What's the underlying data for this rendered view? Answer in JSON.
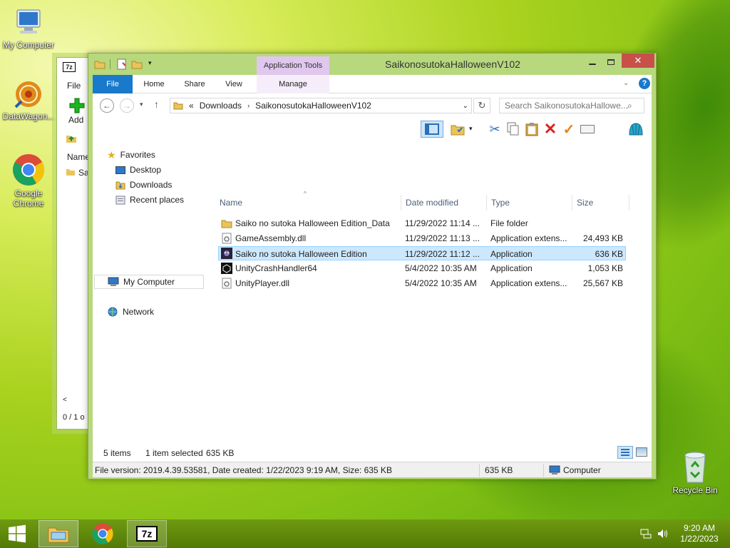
{
  "desktop": {
    "icons": [
      {
        "label": "My Computer"
      },
      {
        "label": "DataWagon..."
      },
      {
        "label": "Google Chrome"
      },
      {
        "label": "Recycle Bin"
      }
    ]
  },
  "sevenzip_window": {
    "title_icon": "7z",
    "menu_file": "File",
    "add_label": "Add",
    "col_name": "Name",
    "row_text": "Sa",
    "status": "0 / 1 o"
  },
  "explorer": {
    "title": "SaikonosutokaHalloweenV102",
    "context_tab": "Application Tools",
    "tabs": {
      "file": "File",
      "home": "Home",
      "share": "Share",
      "view": "View",
      "manage": "Manage"
    },
    "address": {
      "prefix": "«",
      "crumb1": "Downloads",
      "crumb2": "SaikonosutokaHalloweenV102"
    },
    "search_placeholder": "Search SaikonosutokaHallowe...",
    "nav": {
      "favorites": "Favorites",
      "desktop": "Desktop",
      "downloads": "Downloads",
      "recent": "Recent places",
      "computer": "My Computer",
      "network": "Network"
    },
    "columns": {
      "name": "Name",
      "date": "Date modified",
      "type": "Type",
      "size": "Size"
    },
    "files": [
      {
        "name": "Saiko no sutoka Halloween Edition_Data",
        "date": "11/29/2022 11:14 ...",
        "type": "File folder",
        "size": ""
      },
      {
        "name": "GameAssembly.dll",
        "date": "11/29/2022 11:13 ...",
        "type": "Application extens...",
        "size": "24,493 KB"
      },
      {
        "name": "Saiko no sutoka Halloween Edition",
        "date": "11/29/2022 11:12 ...",
        "type": "Application",
        "size": "636 KB"
      },
      {
        "name": "UnityCrashHandler64",
        "date": "5/4/2022 10:35 AM",
        "type": "Application",
        "size": "1,053 KB"
      },
      {
        "name": "UnityPlayer.dll",
        "date": "5/4/2022 10:35 AM",
        "type": "Application extens...",
        "size": "25,567 KB"
      }
    ],
    "status": {
      "count": "5 items",
      "selected": "1 item selected",
      "selsize": "635 KB"
    },
    "fileinfo": {
      "details": "File version: 2019.4.39.53581, Date created: 1/22/2023 9:19 AM, Size: 635 KB",
      "size": "635 KB",
      "location": "Computer"
    }
  },
  "taskbar": {
    "time": "9:20 AM",
    "date": "1/22/2023",
    "sevenzip_label": "7z"
  },
  "colors": {
    "accent": "#1979ca",
    "selection": "#cce8ff",
    "window_frame": "#b7d87d"
  }
}
